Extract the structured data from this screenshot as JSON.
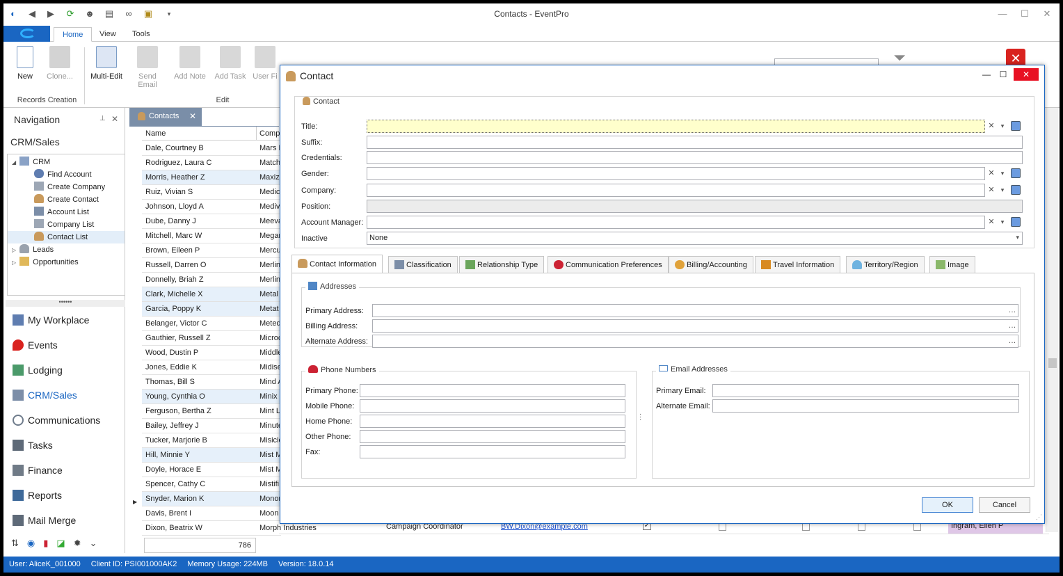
{
  "window": {
    "title": "Contacts - EventPro"
  },
  "ribbon": {
    "tabs": [
      "Home",
      "View",
      "Tools"
    ],
    "buttons": {
      "new": "New",
      "clone": "Clone...",
      "multi_edit": "Multi-Edit",
      "send_email": "Send Email",
      "add_note": "Add Note",
      "add_task": "Add Task",
      "user_fields": "User Fi"
    },
    "groups": {
      "records_creation": "Records Creation",
      "edit": "Edit"
    }
  },
  "navigation": {
    "header": "Navigation",
    "section": "CRM/Sales",
    "tree": {
      "crm": "CRM",
      "find_account": "Find Account",
      "create_company": "Create Company",
      "create_contact": "Create Contact",
      "account_list": "Account List",
      "company_list": "Company List",
      "contact_list": "Contact List",
      "leads": "Leads",
      "opportunities": "Opportunities"
    },
    "modules": {
      "my_workplace": "My Workplace",
      "events": "Events",
      "lodging": "Lodging",
      "crm_sales": "CRM/Sales",
      "communications": "Communications",
      "tasks": "Tasks",
      "finance": "Finance",
      "reports": "Reports",
      "mail_merge": "Mail Merge"
    }
  },
  "grid": {
    "tab_label": "Contacts",
    "columns": {
      "name": "Name",
      "company": "Compa"
    },
    "rows": [
      {
        "name": "Dale, Courtney B",
        "company": "Mars M"
      },
      {
        "name": "Rodriguez, Laura C",
        "company": "Match"
      },
      {
        "name": "Morris, Heather Z",
        "company": "Maxiz"
      },
      {
        "name": "Ruiz, Vivian S",
        "company": "Medica"
      },
      {
        "name": "Johnson, Lloyd A",
        "company": "Medivi"
      },
      {
        "name": "Dube, Danny J",
        "company": "Meeva"
      },
      {
        "name": "Mitchell, Marc W",
        "company": "Megan"
      },
      {
        "name": "Brown, Eileen P",
        "company": "Mercu"
      },
      {
        "name": "Russell, Darren O",
        "company": "Merlin"
      },
      {
        "name": "Donnelly, Briah Z",
        "company": "Merlin"
      },
      {
        "name": "Clark, Michelle X",
        "company": "Metal"
      },
      {
        "name": "Garcia, Poppy K",
        "company": "Metat"
      },
      {
        "name": "Belanger, Victor C",
        "company": "Meted"
      },
      {
        "name": "Gauthier, Russell Z",
        "company": "Microc"
      },
      {
        "name": "Wood, Dustin P",
        "company": "Middle"
      },
      {
        "name": "Jones, Eddie K",
        "company": "Midise"
      },
      {
        "name": "Thomas, Bill S",
        "company": "Mind A"
      },
      {
        "name": "Young, Cynthia O",
        "company": "Minix I"
      },
      {
        "name": "Ferguson, Bertha Z",
        "company": "Mint L"
      },
      {
        "name": "Bailey, Jeffrey J",
        "company": "Minute"
      },
      {
        "name": "Tucker, Marjorie B",
        "company": "Misicio"
      },
      {
        "name": "Hill, Minnie Y",
        "company": "Mist M"
      },
      {
        "name": "Doyle, Horace E",
        "company": "Mist M"
      },
      {
        "name": "Spencer, Cathy C",
        "company": "Mistifi"
      },
      {
        "name": "Snyder, Marion K",
        "company": "Monor"
      },
      {
        "name": "Davis, Brent I",
        "company": "Moon"
      },
      {
        "name": "Dixon, Beatrix W",
        "company": "Morph Industries"
      }
    ],
    "bottom_row": {
      "position": "Campaign Coordinator",
      "email": "BW.Dixon@example.com",
      "manager": "Ingram, Ellen P"
    },
    "count": "786"
  },
  "dialog": {
    "title": "Contact",
    "group": "Contact",
    "fields": {
      "title": "Title:",
      "suffix": "Suffix:",
      "credentials": "Credentials:",
      "gender": "Gender:",
      "company": "Company:",
      "position": "Position:",
      "account_manager": "Account Manager:",
      "inactive": "Inactive",
      "inactive_value": "None"
    },
    "tabs": {
      "contact_info": "Contact Information",
      "classification": "Classification",
      "relationship": "Relationship Type",
      "comm_prefs": "Communication Preferences",
      "billing": "Billing/Accounting",
      "travel": "Travel Information",
      "territory": "Territory/Region",
      "image": "Image"
    },
    "addresses": {
      "legend": "Addresses",
      "primary": "Primary Address:",
      "billing": "Billing Address:",
      "alternate": "Alternate Address:"
    },
    "phones": {
      "legend": "Phone Numbers",
      "primary": "Primary Phone:",
      "mobile": "Mobile Phone:",
      "home": "Home Phone:",
      "other": "Other Phone:",
      "fax": "Fax:"
    },
    "emails": {
      "legend": "Email Addresses",
      "primary": "Primary Email:",
      "alternate": "Alternate Email:"
    },
    "ok": "OK",
    "cancel": "Cancel"
  },
  "status": {
    "user": "User: AliceK_001000",
    "client": "Client ID: PSI001000AK2",
    "memory": "Memory Usage: 224MB",
    "version": "Version: 18.0.14"
  }
}
